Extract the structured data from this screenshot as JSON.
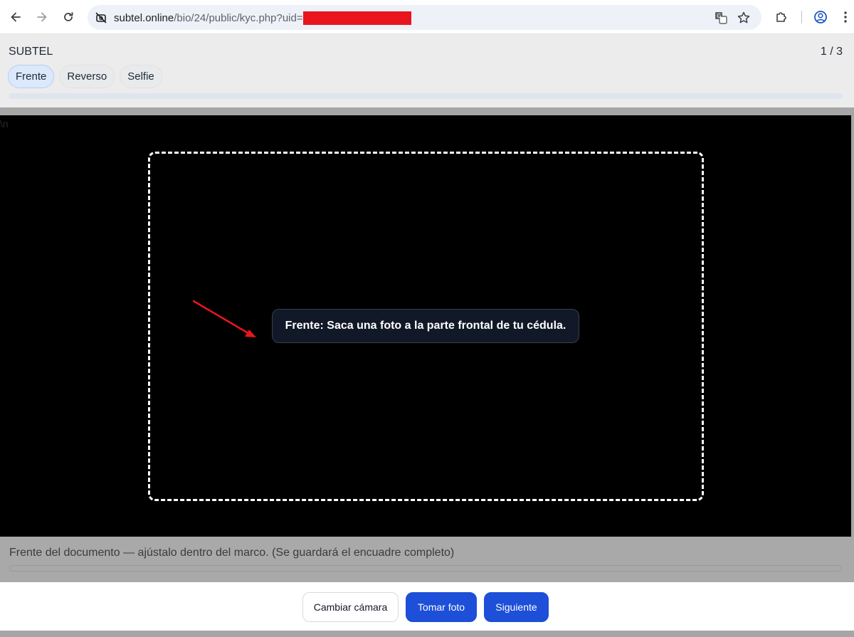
{
  "browser": {
    "url_domain": "subtel.online",
    "url_path": "/bio/24/public/kyc.php?uid=",
    "icons": [
      "back-icon",
      "forward-icon",
      "reload-icon",
      "site-info-icon",
      "translate-icon",
      "bookmark-star-icon",
      "extensions-icon",
      "profile-icon",
      "more-menu-icon"
    ],
    "redaction_color": "#e8151d"
  },
  "header": {
    "brand": "SUBTEL",
    "step_counter": "1 / 3",
    "tabs": [
      {
        "label": "Frente",
        "active": true
      },
      {
        "label": "Reverso",
        "active": false
      },
      {
        "label": "Selfie",
        "active": false
      }
    ],
    "progress_fraction": 0
  },
  "camera": {
    "stray_text": "\\n",
    "hint": "Frente: Saca una foto a la parte frontal de tu cédula."
  },
  "footer": {
    "caption": "Frente del documento — ajústalo dentro del marco. (Se guardará el encuadre completo)"
  },
  "actions": {
    "switch_camera": "Cambiar cámara",
    "take_photo": "Tomar foto",
    "next": "Siguiente"
  },
  "colors": {
    "primary": "#1d4fd8",
    "active_tab_bg": "#dce8fb",
    "annotation_arrow": "#e8151d"
  }
}
